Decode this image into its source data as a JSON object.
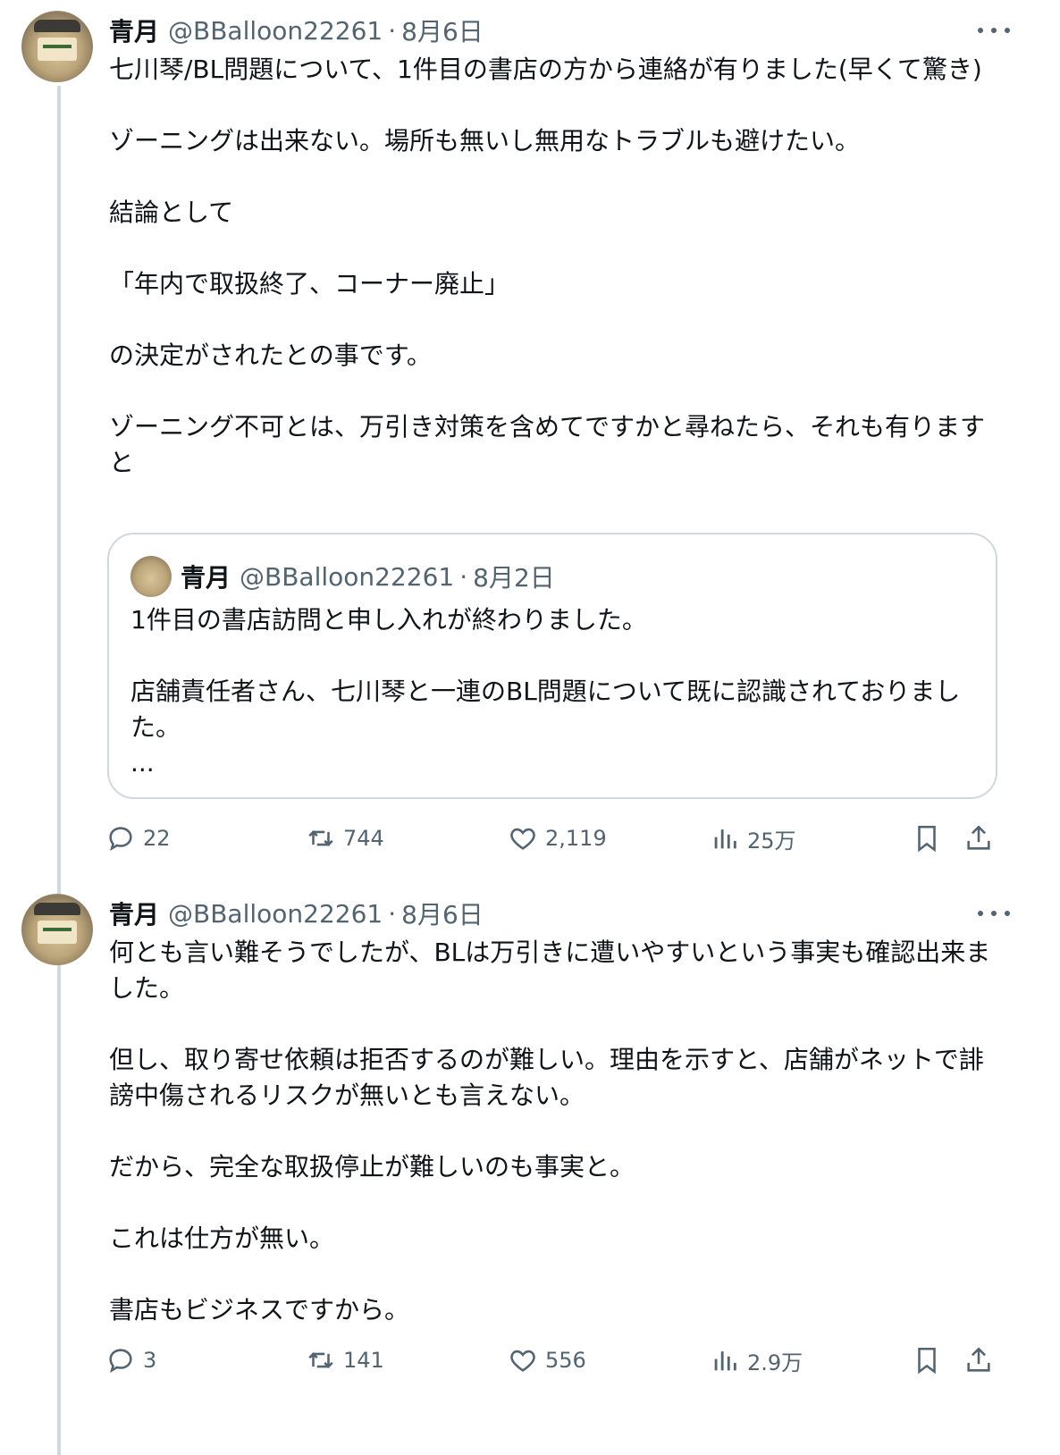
{
  "tweets": [
    {
      "author": {
        "name": "青月",
        "handle": "@BBalloon22261",
        "date": "8月6日",
        "separator": "·"
      },
      "text": "七川琴/BL問題について、1件目の書店の方から連絡が有りました(早くて驚き)\n\nゾーニングは出来ない。場所も無いし無用なトラブルも避けたい。\n\n結論として\n\n「年内で取扱終了、コーナー廃止」\n\nの決定がされたとの事です。\n\nゾーニング不可とは、万引き対策を含めてですかと尋ねたら、それも有りますと",
      "quote": {
        "author": {
          "name": "青月",
          "handle": "@BBalloon22261",
          "date": "8月2日",
          "separator": "·"
        },
        "text": "1件目の書店訪問と申し入れが終わりました。\n\n店舗責任者さん、七川琴と一連のBL問題について既に認識されておりました。\n..."
      },
      "stats": {
        "replies": "22",
        "retweets": "744",
        "likes": "2,119",
        "views": "25万"
      }
    },
    {
      "author": {
        "name": "青月",
        "handle": "@BBalloon22261",
        "date": "8月6日",
        "separator": "·"
      },
      "text": "何とも言い難そうでしたが、BLは万引きに遭いやすいという事実も確認出来ました。\n\n但し、取り寄せ依頼は拒否するのが難しい。理由を示すと、店舗がネットで誹謗中傷されるリスクが無いとも言えない。\n\nだから、完全な取扱停止が難しいのも事実と。\n\nこれは仕方が無い。\n\n書店もビジネスですから。",
      "stats": {
        "replies": "3",
        "retweets": "141",
        "likes": "556",
        "views": "2.9万"
      }
    }
  ],
  "icons": [
    "reply-icon",
    "retweet-icon",
    "like-icon",
    "views-icon",
    "bookmark-icon",
    "share-icon",
    "more-icon"
  ],
  "colors": {
    "text": "#0f1419",
    "secondary": "#536471",
    "border": "#cfd9de",
    "background": "#ffffff"
  }
}
